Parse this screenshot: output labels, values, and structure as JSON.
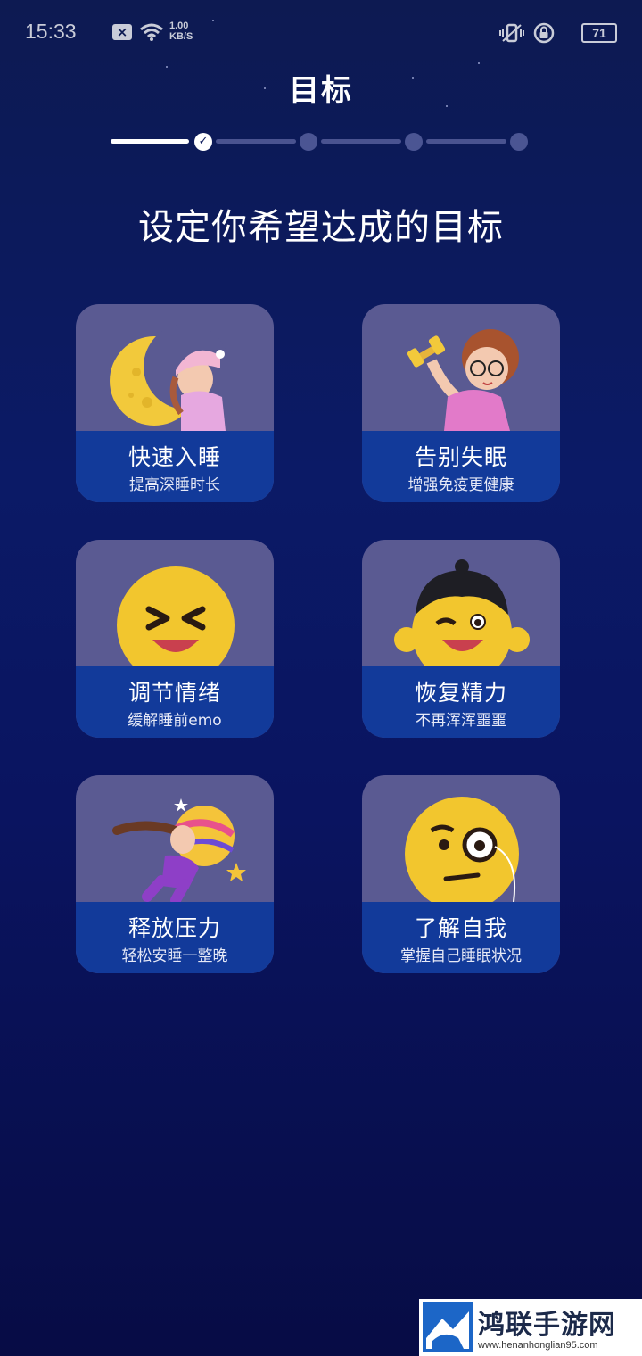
{
  "status_bar": {
    "time": "15:33",
    "net_speed": "1.00",
    "net_unit": "KB/S",
    "battery": "71",
    "icons": [
      "close-notification-icon",
      "wifi-icon",
      "vibrate-icon",
      "rotation-lock-icon",
      "battery-icon"
    ]
  },
  "header": {
    "title": "目标"
  },
  "stepper": {
    "total_steps": 4,
    "current_step": 1
  },
  "headline": "设定你希望达成的目标",
  "goals": [
    {
      "title": "快速入睡",
      "subtitle": "提高深睡时长",
      "illustration": "girl-sleeping-on-moon"
    },
    {
      "title": "告别失眠",
      "subtitle": "增强免疫更健康",
      "illustration": "girl-lifting-dumbbell"
    },
    {
      "title": "调节情绪",
      "subtitle": "缓解睡前emo",
      "illustration": "laughing-face-emoji"
    },
    {
      "title": "恢复精力",
      "subtitle": "不再浑浑噩噩",
      "illustration": "winking-boy-emoji"
    },
    {
      "title": "释放压力",
      "subtitle": "轻松安睡一整晚",
      "illustration": "girl-hugging-planet"
    },
    {
      "title": "了解自我",
      "subtitle": "掌握自己睡眠状况",
      "illustration": "monocle-thinking-emoji"
    }
  ],
  "watermark": {
    "name": "鸿联手游网",
    "url": "www.henanhonglian95.com"
  },
  "colors": {
    "background": "#0b1a66",
    "card": "#5a5a92",
    "card_label": "#123a9a",
    "accent": "#f5c51b"
  }
}
